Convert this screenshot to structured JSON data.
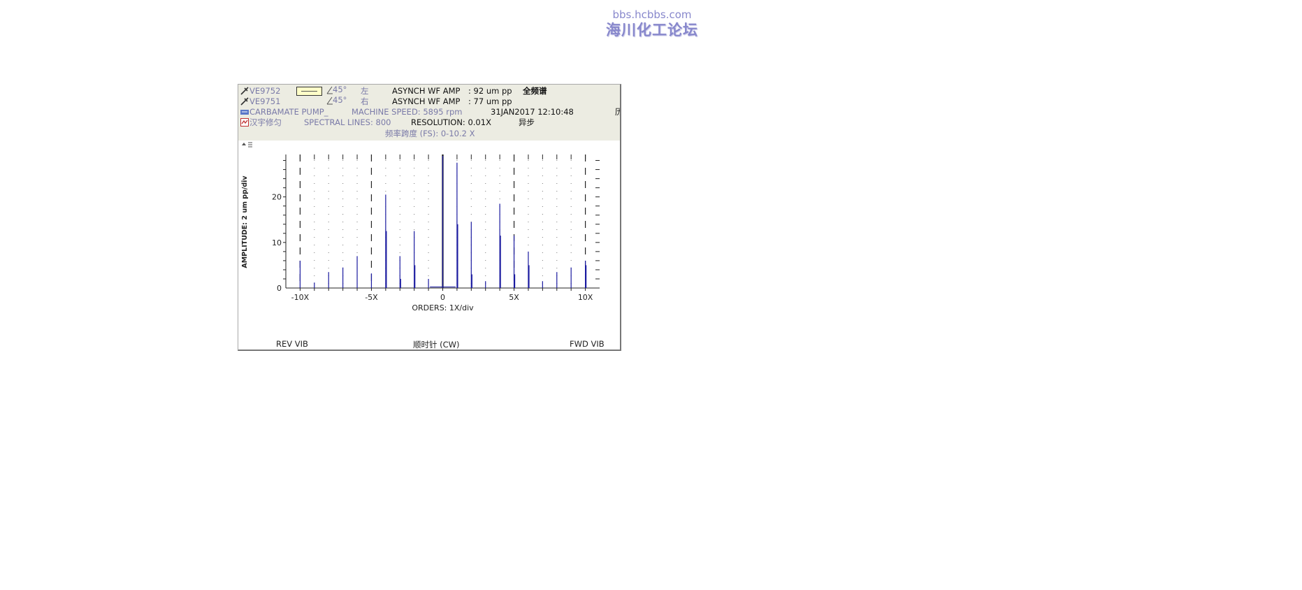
{
  "watermark": {
    "url": "bbs.hcbbs.com",
    "name": "海川化工论坛"
  },
  "header": {
    "probe1": {
      "id": "VE9752",
      "angle": "45°",
      "side": "左",
      "amp_label": "ASYNCH WF AMP",
      "amp_value": ": 92 um pp",
      "extra": "全频谱"
    },
    "probe2": {
      "id": "VE9751",
      "angle": "45°",
      "side": "右",
      "amp_label": "ASYNCH WF AMP",
      "amp_value": ": 77 um pp"
    },
    "machine": {
      "name": "CARBAMATE PUMP_",
      "speed": "MACHINE SPEED: 5895 rpm",
      "timestamp": "31JAN2017 12:10:48",
      "cut": "历"
    },
    "row4": {
      "name": "汉宇修匀",
      "lines": "SPECTRAL LINES: 800",
      "resolution": "RESOLUTION:  0.01X",
      "mode": "异步"
    },
    "span": "频率跨度 (FS): 0-10.2 X",
    "scroll_icon": "scroll-arrows-icon"
  },
  "footer": {
    "left": "REV VIB",
    "center": "顺时针 (CW)",
    "right": "FWD VIB"
  },
  "colors": {
    "spectrum": "#1a1aa0",
    "header_bg": "#ecece2"
  },
  "chart_data": {
    "type": "bar",
    "title": "",
    "xlabel": "ORDERS: 1X/div",
    "ylabel": "AMPLITUDE:  2 um pp/div",
    "xlim": [
      -11,
      11
    ],
    "ylim": [
      0,
      29
    ],
    "x_ticks": [
      {
        "v": -10,
        "label": "-10X"
      },
      {
        "v": -5,
        "label": "-5X"
      },
      {
        "v": 0,
        "label": "0"
      },
      {
        "v": 5,
        "label": "5X"
      },
      {
        "v": 10,
        "label": "10X"
      }
    ],
    "y_ticks": [
      {
        "v": 0,
        "label": "0"
      },
      {
        "v": 10,
        "label": "10"
      },
      {
        "v": 20,
        "label": "20"
      }
    ],
    "dashed_x": [
      -10,
      -5,
      0,
      5,
      10
    ],
    "grid": "dotted",
    "x": [
      -10,
      -9,
      -8,
      -7,
      -6,
      -5,
      -4,
      -3.95,
      -3,
      -2.95,
      -2,
      -1.95,
      -1,
      0,
      1,
      1.05,
      2,
      2.05,
      3,
      4,
      4.05,
      5,
      5.05,
      6,
      6.05,
      7,
      8,
      9,
      10,
      10.05
    ],
    "values": [
      6,
      1.2,
      3.5,
      4.5,
      7,
      3.2,
      20.5,
      12.5,
      7,
      2,
      12.5,
      5,
      2,
      29,
      27.5,
      14,
      14.5,
      3,
      1.5,
      18.5,
      11.5,
      11.5,
      3,
      8,
      5,
      1.5,
      3.5,
      4.5,
      6,
      5
    ]
  }
}
